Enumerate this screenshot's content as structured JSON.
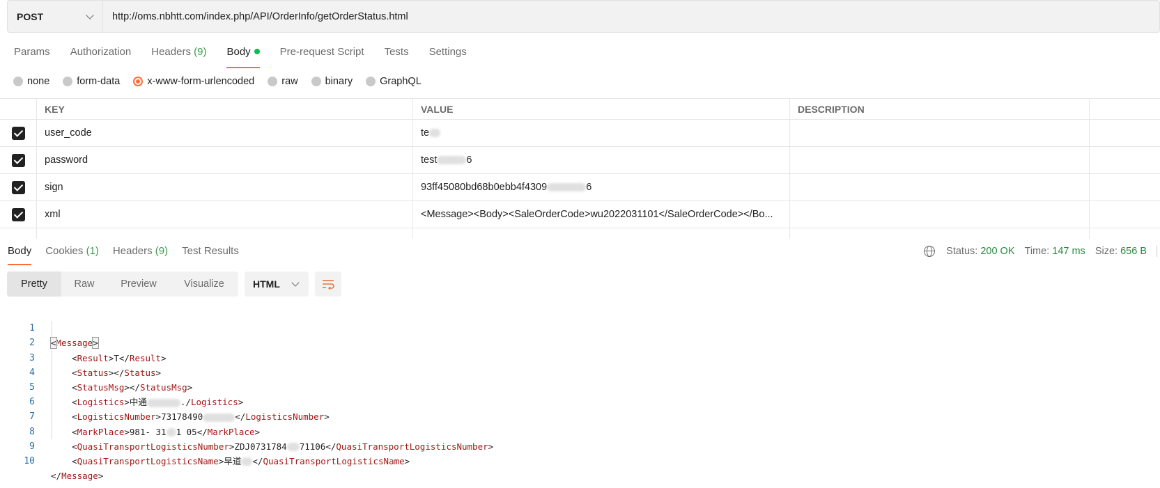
{
  "request": {
    "method": "POST",
    "url": "http://oms.nbhtt.com/index.php/API/OrderInfo/getOrderStatus.html"
  },
  "request_tabs": [
    {
      "label": "Params"
    },
    {
      "label": "Authorization"
    },
    {
      "label": "Headers",
      "count": "(9)"
    },
    {
      "label": "Body",
      "active": true
    },
    {
      "label": "Pre-request Script"
    },
    {
      "label": "Tests"
    },
    {
      "label": "Settings"
    }
  ],
  "body_types": [
    {
      "label": "none"
    },
    {
      "label": "form-data"
    },
    {
      "label": "x-www-form-urlencoded",
      "selected": true
    },
    {
      "label": "raw"
    },
    {
      "label": "binary"
    },
    {
      "label": "GraphQL"
    }
  ],
  "params": {
    "headers": {
      "key": "KEY",
      "value": "VALUE",
      "description": "DESCRIPTION"
    },
    "rows": [
      {
        "key": "user_code",
        "value": "te",
        "checked": true
      },
      {
        "key": "password",
        "value": "test",
        "value_tail": "6",
        "checked": true
      },
      {
        "key": "sign",
        "value": "93ff45080bd68b0ebb4f4309",
        "value_tail": "6",
        "checked": true
      },
      {
        "key": "xml",
        "value": "<Message><Body><SaleOrderCode>wu2022031101</SaleOrderCode></Bo...",
        "checked": true
      }
    ]
  },
  "response_tabs": [
    {
      "label": "Body",
      "active": true
    },
    {
      "label": "Cookies",
      "count": "(1)"
    },
    {
      "label": "Headers",
      "count": "(9)"
    },
    {
      "label": "Test Results"
    }
  ],
  "response_status": {
    "status_label": "Status:",
    "status_value": "200 OK",
    "time_label": "Time:",
    "time_value": "147 ms",
    "size_label": "Size:",
    "size_value": "656 B"
  },
  "view_modes": [
    "Pretty",
    "Raw",
    "Preview",
    "Visualize"
  ],
  "format": "HTML",
  "code_lines": [
    {
      "n": "1"
    },
    {
      "n": "2"
    },
    {
      "n": "3"
    },
    {
      "n": "4"
    },
    {
      "n": "5"
    },
    {
      "n": "6"
    },
    {
      "n": "7"
    },
    {
      "n": "8"
    },
    {
      "n": "9"
    },
    {
      "n": "10"
    }
  ],
  "code": {
    "l1": {
      "open": "Message"
    },
    "l2": {
      "open": "Result",
      "text": "T",
      "close": "Result"
    },
    "l3": {
      "open": "Status",
      "text": "",
      "close": "Status"
    },
    "l4": {
      "open": "StatusMsg",
      "text": "",
      "close": "StatusMsg"
    },
    "l5": {
      "open": "Logistics",
      "text": "中通",
      "text_tail": ".",
      "close": "Logistics"
    },
    "l6": {
      "open": "LogisticsNumber",
      "text": "73178490",
      "text_tail": "",
      "close": "LogisticsNumber"
    },
    "l7": {
      "open": "MarkPlace",
      "text": "981- 31",
      "text_tail": "1 05",
      "close": "MarkPlace"
    },
    "l8": {
      "open": "QuasiTransportLogisticsNumber",
      "text": "ZDJ0731784",
      "text_tail": "71106",
      "close": "QuasiTransportLogisticsNumber"
    },
    "l9": {
      "open": "QuasiTransportLogisticsName",
      "text": "早道",
      "text_tail": "",
      "close": "QuasiTransportLogisticsName"
    },
    "l10": {
      "close": "Message"
    }
  }
}
